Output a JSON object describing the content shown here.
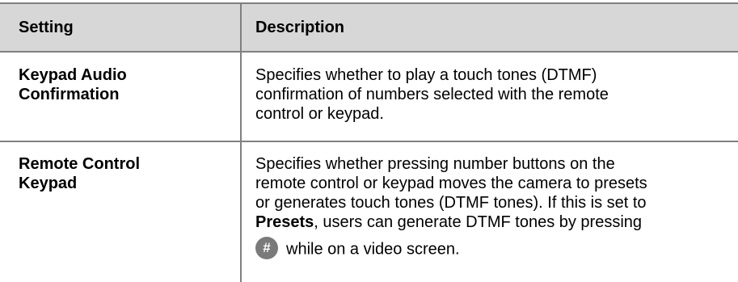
{
  "table": {
    "headers": {
      "setting": "Setting",
      "description": "Description"
    },
    "rows": [
      {
        "setting": [
          "Keypad Audio",
          "Confirmation"
        ],
        "description": [
          "Specifies whether to play a touch tones (DTMF)",
          "confirmation of numbers selected with the remote",
          "control or keypad."
        ]
      },
      {
        "setting": [
          "Remote Control",
          "Keypad"
        ],
        "description": [
          "Specifies whether pressing number buttons on the",
          "remote control or keypad moves the camera to presets",
          "or generates touch tones (DTMF tones). If this is set to"
        ],
        "description_bold": "Presets",
        "description_after_bold": ", users can generate DTMF tones by pressing",
        "icon_symbol": "#",
        "icon_name": "pound-key-icon",
        "description_end": "while on a video screen."
      }
    ]
  }
}
